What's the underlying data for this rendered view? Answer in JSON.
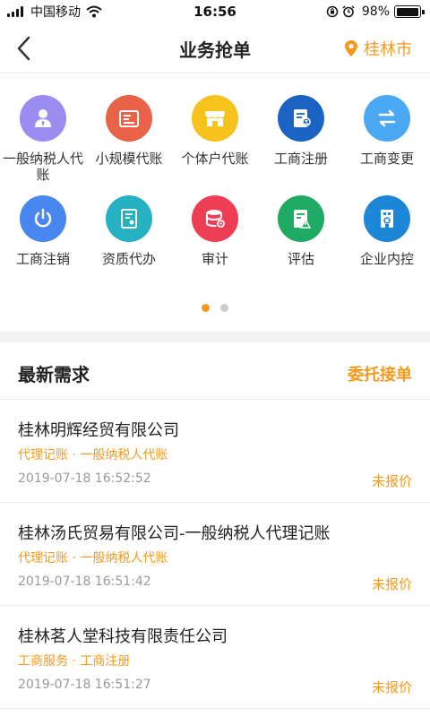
{
  "status_bar": {
    "carrier": "中国移动",
    "time": "16:56",
    "battery": "98%",
    "battery_level": 0.98
  },
  "nav": {
    "title": "业务抢单",
    "city": "桂林市"
  },
  "services": [
    {
      "label": "一般纳税人代账",
      "icon": "person-icon",
      "color": "#9b8df0"
    },
    {
      "label": "小规模代账",
      "icon": "ledger-icon",
      "color": "#e8624a"
    },
    {
      "label": "个体户代账",
      "icon": "shop-icon",
      "color": "#f7c21b"
    },
    {
      "label": "工商注册",
      "icon": "register-document-icon",
      "color": "#1a63c3"
    },
    {
      "label": "工商变更",
      "icon": "swap-arrows-icon",
      "color": "#4aa9f2"
    },
    {
      "label": "工商注销",
      "icon": "power-icon",
      "color": "#4a86ef"
    },
    {
      "label": "资质代办",
      "icon": "certificate-icon",
      "color": "#25b1c2"
    },
    {
      "label": "审计",
      "icon": "database-icon",
      "color": "#ee3e55"
    },
    {
      "label": "评估",
      "icon": "assessment-icon",
      "color": "#1faa63"
    },
    {
      "label": "企业内控",
      "icon": "building-icon",
      "color": "#1b87d6"
    }
  ],
  "pager": {
    "count": 2,
    "active": 0
  },
  "section": {
    "title": "最新需求",
    "action": "委托接单"
  },
  "orders": [
    {
      "title": "桂林明辉经贸有限公司",
      "tags": "代理记账 · 一般纳税人代账",
      "time": "2019-07-18 16:52:52",
      "status": "未报价"
    },
    {
      "title": "桂林汤氏贸易有限公司-一般纳税人代理记账",
      "tags": "代理记账 · 一般纳税人代账",
      "time": "2019-07-18 16:51:42",
      "status": "未报价"
    },
    {
      "title": "桂林茗人堂科技有限责任公司",
      "tags": "工商服务 · 工商注册",
      "time": "2019-07-18 16:51:27",
      "status": "未报价"
    }
  ],
  "colors": {
    "accent": "#f39a1e",
    "dot_active": "#f39a1e",
    "dot_inactive": "#cccccc"
  }
}
